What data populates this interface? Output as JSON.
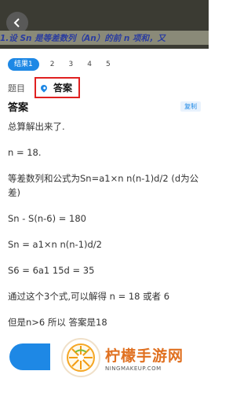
{
  "header": {
    "back_icon": "chevron-left-icon",
    "question_preview": "1.设 Sn 是等差数列（An）的前 n 项和，又"
  },
  "tabs": [
    {
      "label": "结果1",
      "active": true
    },
    {
      "label": "2",
      "active": false
    },
    {
      "label": "3",
      "active": false
    },
    {
      "label": "4",
      "active": false
    },
    {
      "label": "5",
      "active": false
    }
  ],
  "subnav": {
    "question_label": "题目",
    "answer_label": "答案",
    "answer_icon": "location-pin-icon"
  },
  "answer": {
    "title": "答案",
    "copy_label": "复制",
    "lines": [
      "总算解出来了.",
      "n = 18.",
      "等差数列和公式为Sn=a1×n n(n-1)d/2 (d为公差)",
      "Sn - S(n-6) = 180",
      "Sn = a1×n n(n-1)d/2",
      "S6 = 6a1 15d = 35",
      "通过这个3个式,可以解得 n = 18 或者 6",
      "但是n>6 所以 答案是18"
    ]
  },
  "watermark": {
    "name": "柠檬手游网",
    "domain": "NINGMAKEUP.COM"
  },
  "colors": {
    "accent": "#1e88e5",
    "highlight_border": "#e02020",
    "watermark": "#e07020"
  }
}
